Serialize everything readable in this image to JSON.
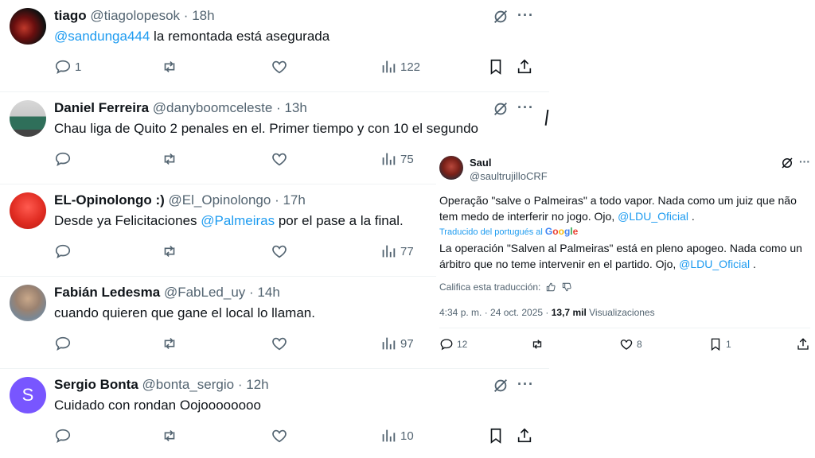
{
  "tweets": [
    {
      "name": "tiago",
      "handle": "@tiagolopesok",
      "sep": "·",
      "time": "18h",
      "mention": "@sandunga444",
      "text": " la remontada está asegurada",
      "reply": "1",
      "retweet": "",
      "like": "",
      "views": "122",
      "show_save": true
    },
    {
      "name": "Daniel Ferreira",
      "handle": "@danyboomceleste",
      "sep": "·",
      "time": "13h",
      "mention": "",
      "text": "Chau liga de Quito 2 penales en el. Primer tiempo y con 10 el segundo",
      "reply": "",
      "retweet": "",
      "like": "",
      "views": "75",
      "show_save": false
    },
    {
      "name": "EL-Opinolongo :)",
      "handle": "@El_Opinolongo",
      "sep": "·",
      "time": "17h",
      "pre": "Desde ya Felicitaciones ",
      "mention": "@Palmeiras",
      "post": " por el pase a la final.",
      "reply": "",
      "retweet": "",
      "like": "",
      "views": "77",
      "show_save": false
    },
    {
      "name": "Fabián Ledesma",
      "handle": "@FabLed_uy",
      "sep": "·",
      "time": "14h",
      "mention": "",
      "text": "cuando quieren que gane el local lo llaman.",
      "reply": "",
      "retweet": "",
      "like": "",
      "views": "97",
      "show_save": false
    },
    {
      "name": "Sergio Bonta",
      "handle": "@bonta_sergio",
      "sep": "·",
      "time": "12h",
      "mention": "",
      "text": "Cuidado con rondan Oojoooooooo",
      "reply": "",
      "retweet": "",
      "like": "",
      "views": "10",
      "show_save": true,
      "avatar_letter": "S"
    }
  ],
  "quote": {
    "name": "Saul",
    "handle": "@saultrujilloCRF",
    "original_pre": "Operação \"salve o Palmeiras\" a todo vapor. Nada como um juiz que não tem medo de interferir no jogo. Ojo, ",
    "original_mention": "@LDU_Oficial",
    "original_post": " .",
    "translated_by": "Traducido del portugués al",
    "google": "Google",
    "translated_pre": "La operación \"Salven al Palmeiras\" está en pleno apogeo. Nada como un árbitro que no teme intervenir en el partido. Ojo, ",
    "translated_mention": "@LDU_Oficial",
    "translated_post": " .",
    "rate_label": "Califica esta traducción:",
    "time": "4:34 p. m. · 24 oct. 2025 · ",
    "views_count": "13,7 mil",
    "views_label": " Visualizaciones",
    "reply_count": "12",
    "like_count": "8",
    "bookmark_count": "1"
  },
  "colors": {
    "accent": "#1d9bf0",
    "muted": "#536471",
    "text": "#0f1419",
    "sergio_avatar": "#7856ff"
  }
}
